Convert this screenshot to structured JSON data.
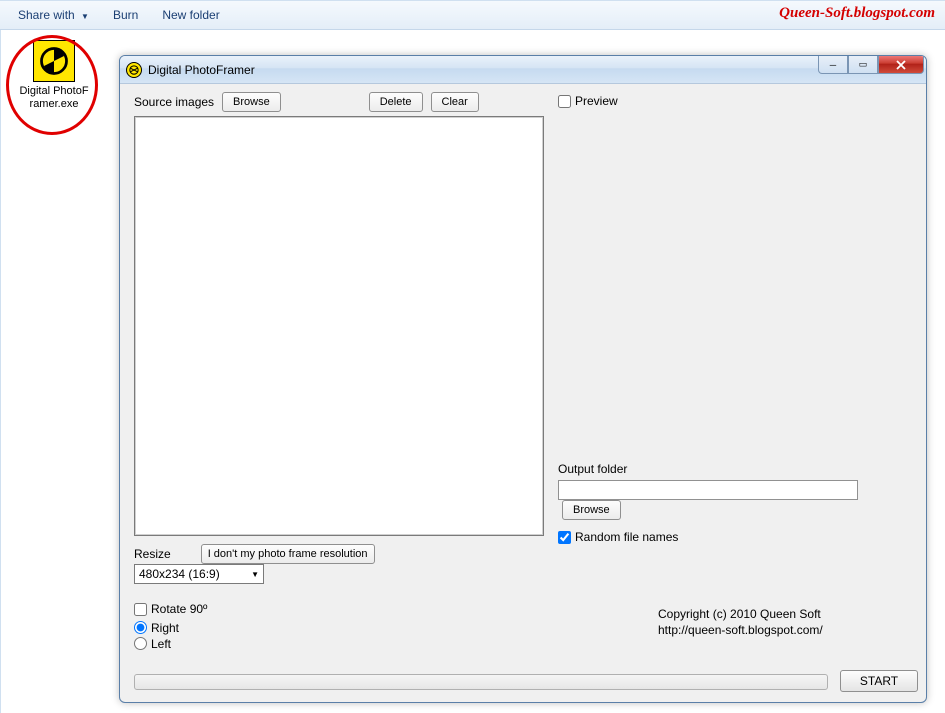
{
  "toolbar": {
    "share_with": "Share with",
    "burn": "Burn",
    "new_folder": "New folder"
  },
  "watermark": "Queen-Soft.blogspot.com",
  "file": {
    "name": "Digital PhotoFramer.exe"
  },
  "window": {
    "title": "Digital PhotoFramer",
    "source_images_label": "Source images",
    "browse": "Browse",
    "delete": "Delete",
    "clear": "Clear",
    "preview": "Preview",
    "resize_label": "Resize",
    "unknown_res_btn": "I don't my photo frame resolution",
    "resize_value": "480x234 (16:9)",
    "rotate_label": "Rotate 90º",
    "rotate_right": "Right",
    "rotate_left": "Left",
    "output_folder_label": "Output folder",
    "output_browse": "Browse",
    "random_names": "Random file names",
    "copyright_line1": "Copyright (c) 2010 Queen Soft",
    "copyright_line2": "http://queen-soft.blogspot.com/",
    "start": "START"
  }
}
